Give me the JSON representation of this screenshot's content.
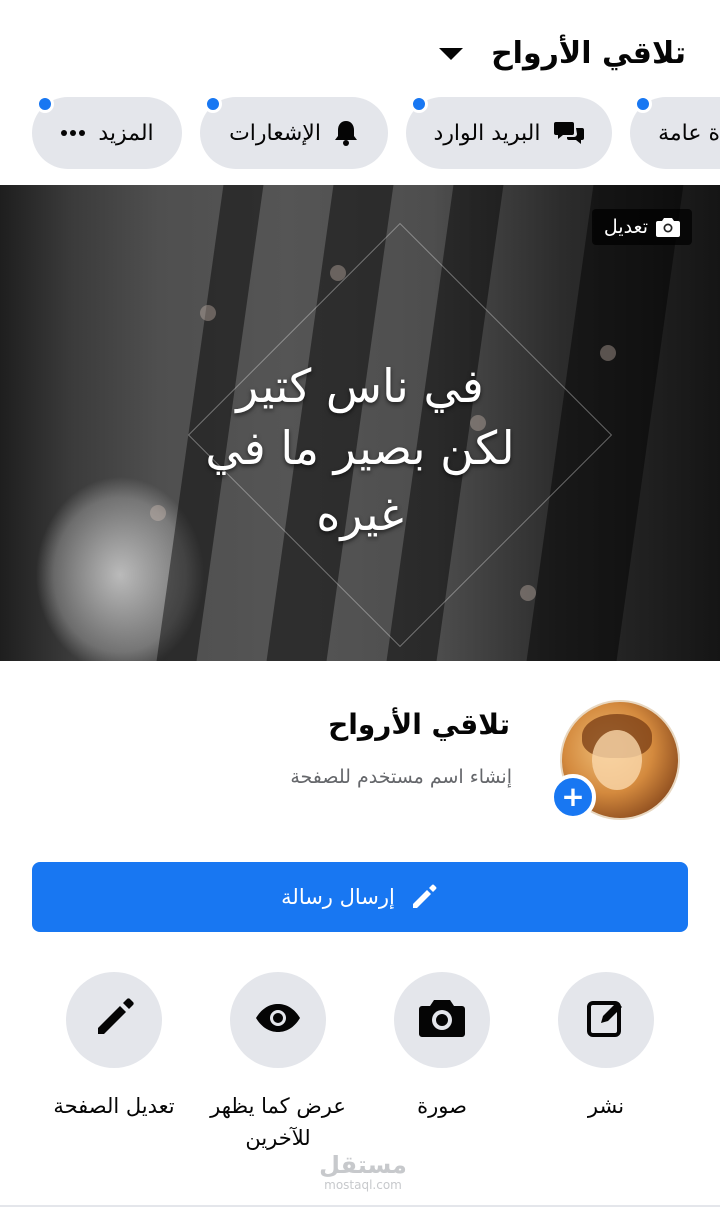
{
  "header": {
    "title": "تلاقي الأرواح",
    "caret_icon": "caret-down-icon"
  },
  "tabs": [
    {
      "label": "المزيد",
      "icon": "more-dots-icon",
      "dot": true
    },
    {
      "label": "الإشعارات",
      "icon": "bell-icon",
      "dot": true
    },
    {
      "label": "البريد الوارد",
      "icon": "chat-bubbles-icon",
      "dot": true
    },
    {
      "label": "ة عامة",
      "icon": "",
      "dot": true
    }
  ],
  "cover": {
    "line1": "في ناس كتير",
    "line2": "لكن بصير ما في",
    "line3": "غيره",
    "edit_label": "تعديل",
    "edit_icon": "camera-icon"
  },
  "profile": {
    "name": "تلاقي الأرواح",
    "username_prompt": "إنشاء اسم مستخدم للصفحة",
    "add_icon": "plus-icon"
  },
  "send_message": {
    "label": "إرسال رسالة",
    "icon": "pencil-icon"
  },
  "actions": [
    {
      "label": "نشر",
      "icon": "compose-icon"
    },
    {
      "label": "صورة",
      "icon": "camera-icon"
    },
    {
      "label": "عرض كما يظهر للآخرين",
      "icon": "eye-icon"
    },
    {
      "label": "تعديل الصفحة",
      "icon": "pencil-icon"
    }
  ],
  "watermark": {
    "name": "مستقل",
    "domain": "mostaql.com"
  },
  "colors": {
    "accent": "#1877f2",
    "pill_bg": "#e4e6eb",
    "text": "#050505",
    "muted": "#65676b"
  }
}
